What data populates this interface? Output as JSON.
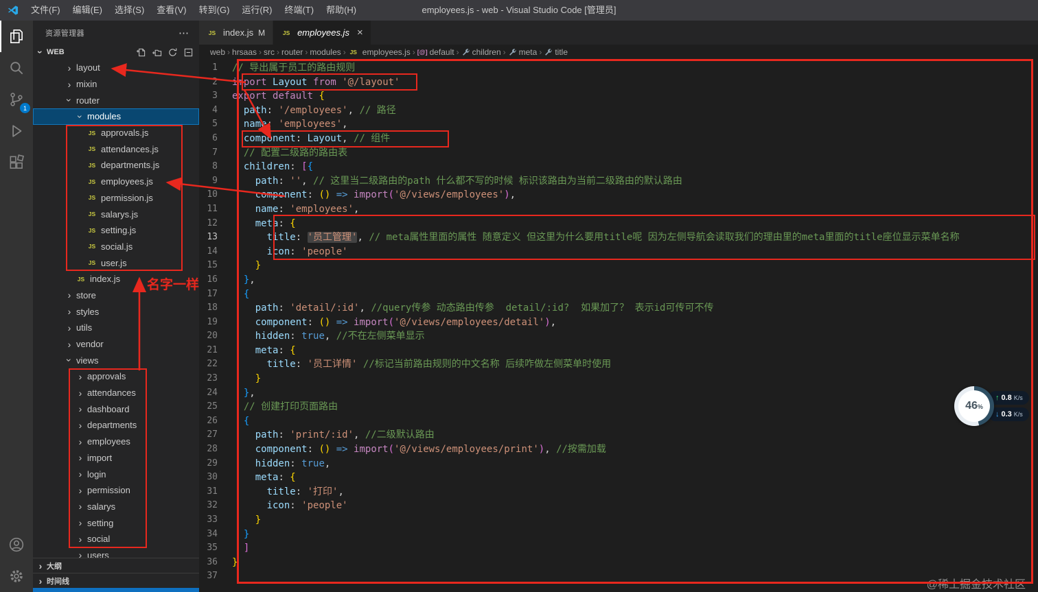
{
  "title_bar": {
    "menus": [
      {
        "label": "文件(F)",
        "name": "file"
      },
      {
        "label": "编辑(E)",
        "name": "edit"
      },
      {
        "label": "选择(S)",
        "name": "selection"
      },
      {
        "label": "查看(V)",
        "name": "view"
      },
      {
        "label": "转到(G)",
        "name": "go"
      },
      {
        "label": "运行(R)",
        "name": "run"
      },
      {
        "label": "终端(T)",
        "name": "terminal"
      },
      {
        "label": "帮助(H)",
        "name": "help"
      }
    ],
    "title": "employees.js - web - Visual Studio Code [管理员]"
  },
  "activity_bar": {
    "badge": "1"
  },
  "icons": {
    "module": "[@]"
  },
  "sidebar": {
    "title": "资源管理器",
    "section": "WEB",
    "tree": [
      {
        "label": "layout",
        "type": "folder",
        "depth": 1,
        "state": "collapsed"
      },
      {
        "label": "mixin",
        "type": "folder",
        "depth": 1,
        "state": "collapsed"
      },
      {
        "label": "router",
        "type": "folder",
        "depth": 1,
        "state": "expanded"
      },
      {
        "label": "modules",
        "type": "folder",
        "depth": 2,
        "state": "expanded",
        "selected": true
      },
      {
        "label": "approvals.js",
        "type": "js",
        "depth": 3
      },
      {
        "label": "attendances.js",
        "type": "js",
        "depth": 3
      },
      {
        "label": "departments.js",
        "type": "js",
        "depth": 3
      },
      {
        "label": "employees.js",
        "type": "js",
        "depth": 3
      },
      {
        "label": "permission.js",
        "type": "js",
        "depth": 3
      },
      {
        "label": "salarys.js",
        "type": "js",
        "depth": 3
      },
      {
        "label": "setting.js",
        "type": "js",
        "depth": 3
      },
      {
        "label": "social.js",
        "type": "js",
        "depth": 3
      },
      {
        "label": "user.js",
        "type": "js",
        "depth": 3
      },
      {
        "label": "index.js",
        "type": "js",
        "depth": 2
      },
      {
        "label": "store",
        "type": "folder",
        "depth": 1,
        "state": "collapsed"
      },
      {
        "label": "styles",
        "type": "folder",
        "depth": 1,
        "state": "collapsed"
      },
      {
        "label": "utils",
        "type": "folder",
        "depth": 1,
        "state": "collapsed"
      },
      {
        "label": "vendor",
        "type": "folder",
        "depth": 1,
        "state": "collapsed"
      },
      {
        "label": "views",
        "type": "folder",
        "depth": 1,
        "state": "expanded"
      },
      {
        "label": "approvals",
        "type": "folder",
        "depth": 2,
        "state": "collapsed"
      },
      {
        "label": "attendances",
        "type": "folder",
        "depth": 2,
        "state": "collapsed"
      },
      {
        "label": "dashboard",
        "type": "folder",
        "depth": 2,
        "state": "collapsed"
      },
      {
        "label": "departments",
        "type": "folder",
        "depth": 2,
        "state": "collapsed"
      },
      {
        "label": "employees",
        "type": "folder",
        "depth": 2,
        "state": "collapsed"
      },
      {
        "label": "import",
        "type": "folder",
        "depth": 2,
        "state": "collapsed"
      },
      {
        "label": "login",
        "type": "folder",
        "depth": 2,
        "state": "collapsed"
      },
      {
        "label": "permission",
        "type": "folder",
        "depth": 2,
        "state": "collapsed"
      },
      {
        "label": "salarys",
        "type": "folder",
        "depth": 2,
        "state": "collapsed"
      },
      {
        "label": "setting",
        "type": "folder",
        "depth": 2,
        "state": "collapsed"
      },
      {
        "label": "social",
        "type": "folder",
        "depth": 2,
        "state": "collapsed"
      },
      {
        "label": "users",
        "type": "folder",
        "depth": 2,
        "state": "collapsed"
      }
    ],
    "panes": [
      {
        "label": "大纲",
        "name": "outline"
      },
      {
        "label": "时间线",
        "name": "timeline"
      }
    ]
  },
  "tabs": [
    {
      "label": "index.js",
      "git": "M",
      "active": false
    },
    {
      "label": "employees.js",
      "active": true
    }
  ],
  "breadcrumb": [
    {
      "label": "web"
    },
    {
      "label": "hrsaas"
    },
    {
      "label": "src"
    },
    {
      "label": "router"
    },
    {
      "label": "modules"
    },
    {
      "label": "employees.js",
      "icon": "js"
    },
    {
      "label": "default",
      "icon": "module"
    },
    {
      "label": "children",
      "icon": "property"
    },
    {
      "label": "meta",
      "icon": "property"
    },
    {
      "label": "title",
      "icon": "property"
    }
  ],
  "editor": {
    "active_line": 13,
    "lines": [
      [
        [
          "cm",
          "// 导出属于员工的路由规则"
        ]
      ],
      [
        [
          "kw",
          "import"
        ],
        [
          "pl",
          " "
        ],
        [
          "def",
          "Layout"
        ],
        [
          "pl",
          " "
        ],
        [
          "kw",
          "from"
        ],
        [
          "pl",
          " "
        ],
        [
          "str",
          "'@/layout'"
        ]
      ],
      [
        [
          "kw",
          "export"
        ],
        [
          "pl",
          " "
        ],
        [
          "kw",
          "default"
        ],
        [
          "pl",
          " "
        ],
        [
          "b1",
          "{"
        ]
      ],
      [
        [
          "pl",
          "  "
        ],
        [
          "prop",
          "path"
        ],
        [
          "pl",
          ": "
        ],
        [
          "str",
          "'/employees'"
        ],
        [
          "pl",
          ", "
        ],
        [
          "cm",
          "// 路径"
        ]
      ],
      [
        [
          "pl",
          "  "
        ],
        [
          "prop",
          "name"
        ],
        [
          "pl",
          ": "
        ],
        [
          "str",
          "'employees'"
        ],
        [
          "pl",
          ","
        ]
      ],
      [
        [
          "pl",
          "  "
        ],
        [
          "prop",
          "component"
        ],
        [
          "pl",
          ": "
        ],
        [
          "def",
          "Layout"
        ],
        [
          "pl",
          ", "
        ],
        [
          "cm",
          "// 组件"
        ]
      ],
      [
        [
          "pl",
          "  "
        ],
        [
          "cm",
          "// 配置二级路的路由表"
        ]
      ],
      [
        [
          "pl",
          "  "
        ],
        [
          "prop",
          "children"
        ],
        [
          "pl",
          ": "
        ],
        [
          "b2",
          "["
        ],
        [
          "b3",
          "{"
        ]
      ],
      [
        [
          "pl",
          "    "
        ],
        [
          "prop",
          "path"
        ],
        [
          "pl",
          ": "
        ],
        [
          "str",
          "''"
        ],
        [
          "pl",
          ", "
        ],
        [
          "cm",
          "// 这里当二级路由的path 什么都不写的时候 标识该路由为当前二级路由的默认路由"
        ]
      ],
      [
        [
          "pl",
          "    "
        ],
        [
          "prop",
          "component"
        ],
        [
          "pl",
          ": "
        ],
        [
          "b1",
          "()"
        ],
        [
          "pl",
          " "
        ],
        [
          "op",
          "=>"
        ],
        [
          "pl",
          " "
        ],
        [
          "kw",
          "import"
        ],
        [
          "b2",
          "("
        ],
        [
          "str",
          "'@/views/employees'"
        ],
        [
          "b2",
          ")"
        ],
        [
          "pl",
          ","
        ]
      ],
      [
        [
          "pl",
          "    "
        ],
        [
          "prop",
          "name"
        ],
        [
          "pl",
          ": "
        ],
        [
          "str",
          "'employees'"
        ],
        [
          "pl",
          ","
        ]
      ],
      [
        [
          "pl",
          "    "
        ],
        [
          "prop",
          "meta"
        ],
        [
          "pl",
          ": "
        ],
        [
          "b1",
          "{"
        ]
      ],
      [
        [
          "pl",
          "      "
        ],
        [
          "prop",
          "title"
        ],
        [
          "pl",
          ": "
        ],
        [
          "strh",
          "'员工管理'"
        ],
        [
          "pl",
          ", "
        ],
        [
          "cm",
          "// meta属性里面的属性 随意定义 但这里为什么要用title呢 因为左侧导航会读取我们的理由里的meta里面的title座位显示菜单名称"
        ]
      ],
      [
        [
          "pl",
          "      "
        ],
        [
          "prop",
          "icon"
        ],
        [
          "pl",
          ": "
        ],
        [
          "str",
          "'people'"
        ]
      ],
      [
        [
          "pl",
          "    "
        ],
        [
          "b1",
          "}"
        ]
      ],
      [
        [
          "pl",
          "  "
        ],
        [
          "b3",
          "}"
        ],
        [
          "pl",
          ","
        ]
      ],
      [
        [
          "pl",
          "  "
        ],
        [
          "b3",
          "{"
        ]
      ],
      [
        [
          "pl",
          "    "
        ],
        [
          "prop",
          "path"
        ],
        [
          "pl",
          ": "
        ],
        [
          "str",
          "'detail/:id'"
        ],
        [
          "pl",
          ", "
        ],
        [
          "cm",
          "//query传参 动态路由传参  detail/:id?  如果加了？ 表示id可传可不传"
        ]
      ],
      [
        [
          "pl",
          "    "
        ],
        [
          "prop",
          "component"
        ],
        [
          "pl",
          ": "
        ],
        [
          "b1",
          "()"
        ],
        [
          "pl",
          " "
        ],
        [
          "op",
          "=>"
        ],
        [
          "pl",
          " "
        ],
        [
          "kw",
          "import"
        ],
        [
          "b2",
          "("
        ],
        [
          "str",
          "'@/views/employees/detail'"
        ],
        [
          "b2",
          ")"
        ],
        [
          "pl",
          ","
        ]
      ],
      [
        [
          "pl",
          "    "
        ],
        [
          "prop",
          "hidden"
        ],
        [
          "pl",
          ": "
        ],
        [
          "bool",
          "true"
        ],
        [
          "pl",
          ", "
        ],
        [
          "cm",
          "//不在左侧菜单显示"
        ]
      ],
      [
        [
          "pl",
          "    "
        ],
        [
          "prop",
          "meta"
        ],
        [
          "pl",
          ": "
        ],
        [
          "b1",
          "{"
        ]
      ],
      [
        [
          "pl",
          "      "
        ],
        [
          "prop",
          "title"
        ],
        [
          "pl",
          ": "
        ],
        [
          "str",
          "'员工详情'"
        ],
        [
          "pl",
          " "
        ],
        [
          "cm",
          "//标记当前路由规则的中文名称 后续咋做左侧菜单时使用"
        ]
      ],
      [
        [
          "pl",
          "    "
        ],
        [
          "b1",
          "}"
        ]
      ],
      [
        [
          "pl",
          "  "
        ],
        [
          "b3",
          "}"
        ],
        [
          "pl",
          ","
        ]
      ],
      [
        [
          "pl",
          "  "
        ],
        [
          "cm",
          "// 创建打印页面路由"
        ]
      ],
      [
        [
          "pl",
          "  "
        ],
        [
          "b3",
          "{"
        ]
      ],
      [
        [
          "pl",
          "    "
        ],
        [
          "prop",
          "path"
        ],
        [
          "pl",
          ": "
        ],
        [
          "str",
          "'print/:id'"
        ],
        [
          "pl",
          ", "
        ],
        [
          "cm",
          "//二级默认路由"
        ]
      ],
      [
        [
          "pl",
          "    "
        ],
        [
          "prop",
          "component"
        ],
        [
          "pl",
          ": "
        ],
        [
          "b1",
          "()"
        ],
        [
          "pl",
          " "
        ],
        [
          "op",
          "=>"
        ],
        [
          "pl",
          " "
        ],
        [
          "kw",
          "import"
        ],
        [
          "b2",
          "("
        ],
        [
          "str",
          "'@/views/employees/print'"
        ],
        [
          "b2",
          ")"
        ],
        [
          "pl",
          ", "
        ],
        [
          "cm",
          "//按需加载"
        ]
      ],
      [
        [
          "pl",
          "    "
        ],
        [
          "prop",
          "hidden"
        ],
        [
          "pl",
          ": "
        ],
        [
          "bool",
          "true"
        ],
        [
          "pl",
          ","
        ]
      ],
      [
        [
          "pl",
          "    "
        ],
        [
          "prop",
          "meta"
        ],
        [
          "pl",
          ": "
        ],
        [
          "b1",
          "{"
        ]
      ],
      [
        [
          "pl",
          "      "
        ],
        [
          "prop",
          "title"
        ],
        [
          "pl",
          ": "
        ],
        [
          "str",
          "'打印'"
        ],
        [
          "pl",
          ","
        ]
      ],
      [
        [
          "pl",
          "      "
        ],
        [
          "prop",
          "icon"
        ],
        [
          "pl",
          ": "
        ],
        [
          "str",
          "'people'"
        ]
      ],
      [
        [
          "pl",
          "    "
        ],
        [
          "b1",
          "}"
        ]
      ],
      [
        [
          "pl",
          "  "
        ],
        [
          "b3",
          "}"
        ]
      ],
      [
        [
          "pl",
          "  "
        ],
        [
          "b2",
          "]"
        ]
      ],
      [
        [
          "b1",
          "}"
        ]
      ],
      []
    ]
  },
  "annotations": {
    "label": "名字一样"
  },
  "speed_widget": {
    "percent": "46",
    "percent_unit": "%",
    "up_value": "0.8",
    "up_unit": "K/s",
    "down_value": "0.3",
    "down_unit": "K/s"
  },
  "watermark": "@稀土掘金技术社区"
}
